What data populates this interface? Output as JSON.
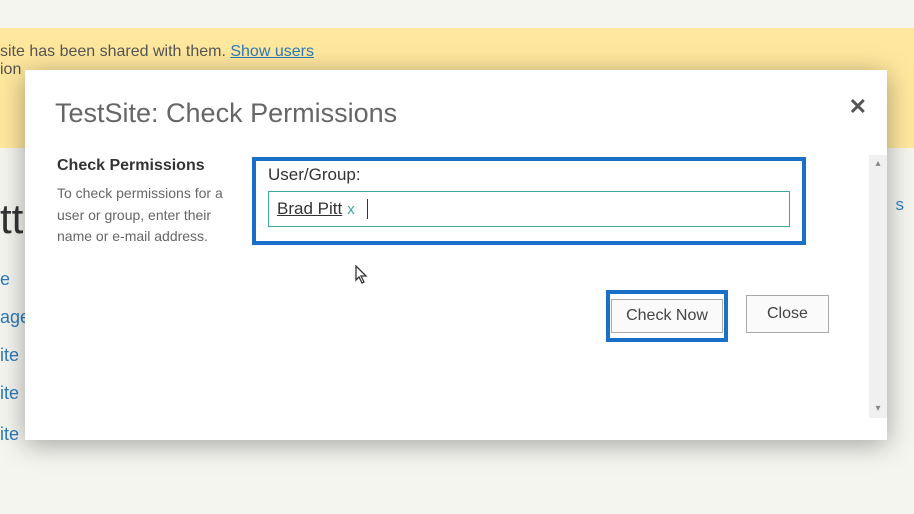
{
  "banner": {
    "text_fragment": "site has been shared with them.",
    "link_text": "Show users",
    "second_line": "ion"
  },
  "background": {
    "big_text": "tt",
    "links": [
      "e",
      "age",
      "ite",
      "ite",
      "ite"
    ],
    "side_letter": "s"
  },
  "dialog": {
    "title": "TestSite: Check Permissions",
    "close_glyph": "✕",
    "left": {
      "heading": "Check Permissions",
      "description": "To check permissions for a user or group, enter their name or e-mail address."
    },
    "form": {
      "label": "User/Group:",
      "chip_name": "Brad Pitt",
      "chip_remove": "x"
    },
    "buttons": {
      "check_now": "Check Now",
      "close": "Close"
    },
    "scroll": {
      "up": "▴",
      "down": "▾"
    }
  }
}
